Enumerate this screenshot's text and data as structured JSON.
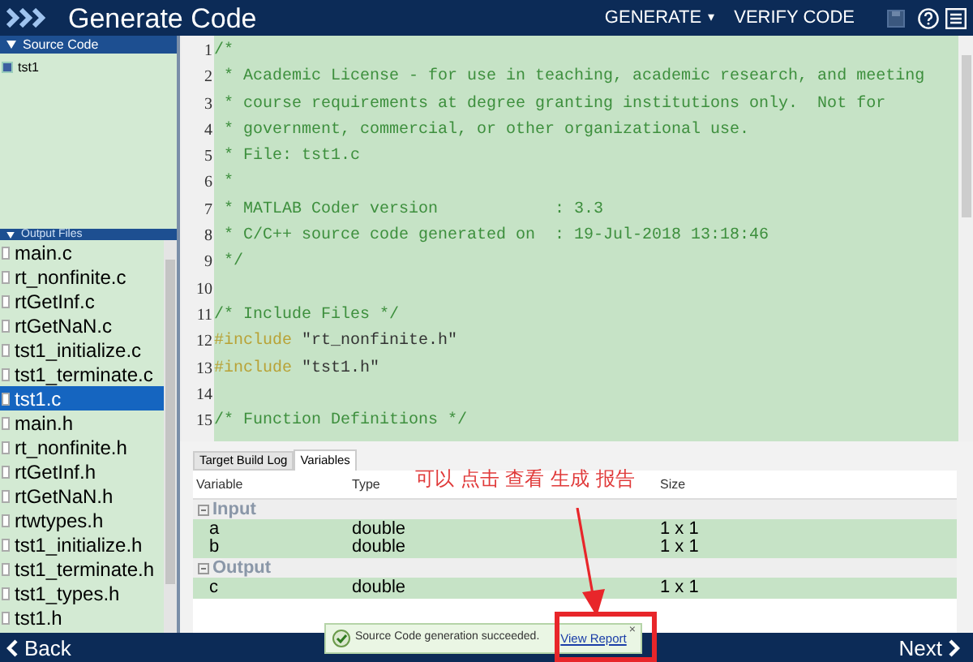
{
  "window": {
    "title": "Generate Code"
  },
  "toolbar": {
    "buttons": [
      {
        "label": "GENERATE",
        "caret": "▾"
      },
      {
        "label": "VERIFY CODE"
      }
    ]
  },
  "source_code": {
    "title": "Source Code",
    "items": [
      {
        "label": "tst1",
        "selected": false
      }
    ]
  },
  "output_files": {
    "title": "Output Files",
    "items": [
      {
        "label": "main.c",
        "selected": false
      },
      {
        "label": "rt_nonfinite.c",
        "selected": false
      },
      {
        "label": "rtGetInf.c",
        "selected": false
      },
      {
        "label": "rtGetNaN.c",
        "selected": false
      },
      {
        "label": "tst1_initialize.c",
        "selected": false
      },
      {
        "label": "tst1_terminate.c",
        "selected": false
      },
      {
        "label": "tst1.c",
        "selected": true
      },
      {
        "label": "main.h",
        "selected": false
      },
      {
        "label": "rt_nonfinite.h",
        "selected": false
      },
      {
        "label": "rtGetInf.h",
        "selected": false
      },
      {
        "label": "rtGetNaN.h",
        "selected": false
      },
      {
        "label": "rtwtypes.h",
        "selected": false
      },
      {
        "label": "tst1_initialize.h",
        "selected": false
      },
      {
        "label": "tst1_terminate.h",
        "selected": false
      },
      {
        "label": "tst1_types.h",
        "selected": false
      },
      {
        "label": "tst1.h",
        "selected": false
      }
    ]
  },
  "code": {
    "lines": [
      {
        "number": "1",
        "segments": [
          {
            "kind": "comment",
            "text": "/*"
          }
        ]
      },
      {
        "number": "2",
        "segments": [
          {
            "kind": "comment",
            "text": " * Academic License - for use in teaching, academic research, and meeting"
          }
        ]
      },
      {
        "number": "3",
        "segments": [
          {
            "kind": "comment",
            "text": " * course requirements at degree granting institutions only.  Not for"
          }
        ]
      },
      {
        "number": "4",
        "segments": [
          {
            "kind": "comment",
            "text": " * government, commercial, or other organizational use."
          }
        ]
      },
      {
        "number": "5",
        "segments": [
          {
            "kind": "comment",
            "text": " * File: tst1.c"
          }
        ]
      },
      {
        "number": "6",
        "segments": [
          {
            "kind": "comment",
            "text": " *"
          }
        ]
      },
      {
        "number": "7",
        "segments": [
          {
            "kind": "comment",
            "text": " * MATLAB Coder version            : 3.3"
          }
        ]
      },
      {
        "number": "8",
        "segments": [
          {
            "kind": "comment",
            "text": " * C/C++ source code generated on  : 19-Jul-2018 13:18:46"
          }
        ]
      },
      {
        "number": "9",
        "segments": [
          {
            "kind": "comment",
            "text": " */"
          }
        ]
      },
      {
        "number": "10"
      },
      {
        "number": "11",
        "segments": [
          {
            "kind": "comment",
            "text": "/* Include Files */"
          }
        ]
      },
      {
        "number": "12",
        "segments": [
          {
            "kind": "directive",
            "text": "#include"
          },
          {
            "kind": "string",
            "text": " \"rt_nonfinite.h\""
          }
        ]
      },
      {
        "number": "13",
        "segments": [
          {
            "kind": "directive",
            "text": "#include"
          },
          {
            "kind": "string",
            "text": " \"tst1.h\""
          }
        ]
      },
      {
        "number": "14"
      },
      {
        "number": "15",
        "segments": [
          {
            "kind": "comment",
            "text": "/* Function Definitions */"
          }
        ]
      }
    ]
  },
  "bottom_panel": {
    "tabs": [
      {
        "label": "Target Build Log",
        "selected": false
      },
      {
        "label": "Variables",
        "selected": true
      }
    ],
    "columns": [
      "Variable",
      "Type",
      "Size"
    ],
    "groups": [
      {
        "name": "Input",
        "expanded": true,
        "rows": [
          {
            "variable": "a",
            "type": "double",
            "size": "1 x 1"
          },
          {
            "variable": "b",
            "type": "double",
            "size": "1 x 1"
          }
        ]
      },
      {
        "name": "Output",
        "expanded": true,
        "rows": [
          {
            "variable": "c",
            "type": "double",
            "size": "1 x 1"
          }
        ]
      }
    ]
  },
  "annotation": {
    "text": "可以 点击 查看 生成 报告"
  },
  "notification": {
    "message": "Source Code generation succeeded.",
    "link": "View Report",
    "close": "×"
  },
  "footer": {
    "back": "Back",
    "next": "Next"
  }
}
